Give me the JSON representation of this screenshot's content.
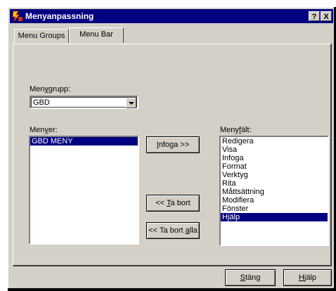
{
  "window": {
    "title": "Menyanpassning",
    "help_btn": "?",
    "close_btn": "X"
  },
  "tabs": [
    {
      "label": "Menu Groups",
      "active": false
    },
    {
      "label": "Menu Bar",
      "active": true
    }
  ],
  "menugroup": {
    "label_pre": "Men",
    "label_u": "y",
    "label_post": "grupp:",
    "value": "GBD"
  },
  "menus": {
    "label_pre": "Men",
    "label_u": "y",
    "label_post": "er:",
    "items": [
      "GBD MENY"
    ],
    "selected_index": 0
  },
  "menubar": {
    "label_pre": "Meny",
    "label_u": "f",
    "label_post": "ält:",
    "items": [
      "Redigera",
      "Visa",
      "Infoga",
      "Format",
      "Verktyg",
      "Rita",
      "Måttsättning",
      "Modifiera",
      "Fönster",
      "Hjälp"
    ],
    "selected_index": 9
  },
  "buttons": {
    "insert": {
      "u": "I",
      "rest": "nfoga >>"
    },
    "remove": {
      "pre": "<< ",
      "u": "T",
      "rest": "a bort"
    },
    "remove_all": {
      "pre": "<< Ta bort ",
      "u": "a",
      "rest": "lla"
    },
    "close": {
      "pre": "",
      "u": "S",
      "rest": "täng"
    },
    "help": {
      "pre": "",
      "u": "H",
      "rest": "jälp"
    }
  },
  "colors": {
    "titlebar": "#000080",
    "selection": "#000080",
    "face": "#d4d0c8"
  }
}
